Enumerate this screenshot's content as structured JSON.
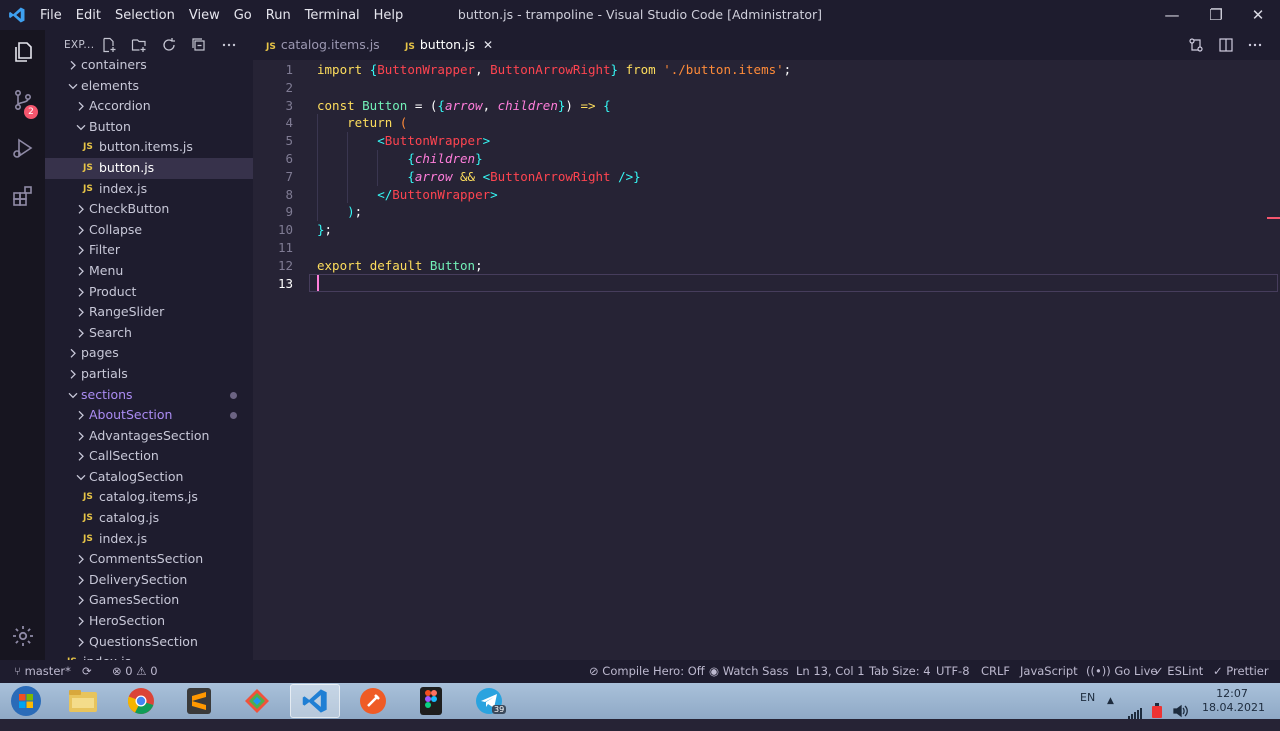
{
  "titlebar": {
    "menu": [
      "File",
      "Edit",
      "Selection",
      "View",
      "Go",
      "Run",
      "Terminal",
      "Help"
    ],
    "window_title": "button.js - trampoline - Visual Studio Code [Administrator]",
    "minimize": "—",
    "maximize": "❐",
    "close": "✕"
  },
  "activity": {
    "scm_badge": "2"
  },
  "sidebar": {
    "header": "EXP...",
    "tree": [
      {
        "label": "containers",
        "depth": 1,
        "chev": "right"
      },
      {
        "label": "elements",
        "depth": 1,
        "chev": "down"
      },
      {
        "label": "Accordion",
        "depth": 2,
        "chev": "right"
      },
      {
        "label": "Button",
        "depth": 2,
        "chev": "down"
      },
      {
        "label": "button.items.js",
        "depth": 3,
        "file": "JS"
      },
      {
        "label": "button.js",
        "depth": 3,
        "file": "JS",
        "selected": true
      },
      {
        "label": "index.js",
        "depth": 3,
        "file": "JS"
      },
      {
        "label": "CheckButton",
        "depth": 2,
        "chev": "right"
      },
      {
        "label": "Collapse",
        "depth": 2,
        "chev": "right"
      },
      {
        "label": "Filter",
        "depth": 2,
        "chev": "right"
      },
      {
        "label": "Menu",
        "depth": 2,
        "chev": "right"
      },
      {
        "label": "Product",
        "depth": 2,
        "chev": "right"
      },
      {
        "label": "RangeSlider",
        "depth": 2,
        "chev": "right"
      },
      {
        "label": "Search",
        "depth": 2,
        "chev": "right"
      },
      {
        "label": "pages",
        "depth": 1,
        "chev": "right"
      },
      {
        "label": "partials",
        "depth": 1,
        "chev": "right"
      },
      {
        "label": "sections",
        "depth": 1,
        "chev": "down",
        "modified": true
      },
      {
        "label": "AboutSection",
        "depth": 2,
        "chev": "right",
        "modified": true
      },
      {
        "label": "AdvantagesSection",
        "depth": 2,
        "chev": "right"
      },
      {
        "label": "CallSection",
        "depth": 2,
        "chev": "right"
      },
      {
        "label": "CatalogSection",
        "depth": 2,
        "chev": "down"
      },
      {
        "label": "catalog.items.js",
        "depth": 3,
        "file": "JS"
      },
      {
        "label": "catalog.js",
        "depth": 3,
        "file": "JS"
      },
      {
        "label": "index.js",
        "depth": 3,
        "file": "JS"
      },
      {
        "label": "CommentsSection",
        "depth": 2,
        "chev": "right"
      },
      {
        "label": "DeliverySection",
        "depth": 2,
        "chev": "right"
      },
      {
        "label": "GamesSection",
        "depth": 2,
        "chev": "right"
      },
      {
        "label": "HeroSection",
        "depth": 2,
        "chev": "right"
      },
      {
        "label": "QuestionsSection",
        "depth": 2,
        "chev": "right"
      },
      {
        "label": "index.js",
        "depth": 1,
        "file": "JS"
      }
    ]
  },
  "tabs": [
    {
      "label": "catalog.items.js",
      "icon": "JS",
      "active": false
    },
    {
      "label": "button.js",
      "icon": "JS",
      "active": true,
      "close": "✕"
    }
  ],
  "editor": {
    "lines": [
      [
        [
          "kw",
          "import "
        ],
        [
          "b",
          "{"
        ],
        [
          "t",
          "ButtonWrapper"
        ],
        [
          "o",
          ", "
        ],
        [
          "t",
          "ButtonArrowRight"
        ],
        [
          "b",
          "}"
        ],
        [
          "kw",
          " from "
        ],
        [
          "s",
          "'./button.items'"
        ],
        [
          "o",
          ";"
        ]
      ],
      [],
      [
        [
          "kw",
          "const "
        ],
        [
          "p",
          "Button"
        ],
        [
          "o",
          " = ("
        ],
        [
          "b",
          "{"
        ],
        [
          "pa",
          "arrow"
        ],
        [
          "o",
          ", "
        ],
        [
          "pa",
          "children"
        ],
        [
          "b",
          "}"
        ],
        [
          "o",
          ") "
        ],
        [
          "kw",
          "=>"
        ],
        [
          "o",
          " "
        ],
        [
          "b",
          "{"
        ]
      ],
      [
        [
          "o",
          "    "
        ],
        [
          "kw",
          "return"
        ],
        [
          "o",
          " "
        ],
        [
          "s",
          "("
        ]
      ],
      [
        [
          "o",
          "        "
        ],
        [
          "b",
          "<"
        ],
        [
          "t",
          "ButtonWrapper"
        ],
        [
          "b",
          ">"
        ]
      ],
      [
        [
          "o",
          "            "
        ],
        [
          "b",
          "{"
        ],
        [
          "pa",
          "children"
        ],
        [
          "b",
          "}"
        ]
      ],
      [
        [
          "o",
          "            "
        ],
        [
          "b",
          "{"
        ],
        [
          "pa",
          "arrow"
        ],
        [
          "o",
          " "
        ],
        [
          "kw",
          "&&"
        ],
        [
          "o",
          " "
        ],
        [
          "b",
          "<"
        ],
        [
          "t",
          "ButtonArrowRight"
        ],
        [
          "o",
          " "
        ],
        [
          "b",
          "/>"
        ],
        [
          "b",
          "}"
        ]
      ],
      [
        [
          "o",
          "        "
        ],
        [
          "b",
          "</"
        ],
        [
          "t",
          "ButtonWrapper"
        ],
        [
          "b",
          ">"
        ]
      ],
      [
        [
          "o",
          "    "
        ],
        [
          "b",
          ")"
        ],
        [
          "o",
          ";"
        ]
      ],
      [
        [
          "b",
          "}"
        ],
        [
          "o",
          ";"
        ]
      ],
      [],
      [
        [
          "kw",
          "export "
        ],
        [
          "kw",
          "default "
        ],
        [
          "p",
          "Button"
        ],
        [
          "o",
          ";"
        ]
      ],
      []
    ],
    "line_numbers": [
      "1",
      "2",
      "3",
      "4",
      "5",
      "6",
      "7",
      "8",
      "9",
      "10",
      "11",
      "12",
      "13"
    ],
    "current_line": 13
  },
  "statusbar": {
    "branch": "master*",
    "errors": "0",
    "warnings": "0",
    "compile_hero": "Compile Hero: Off",
    "watch_sass": "Watch Sass",
    "position": "Ln 13, Col 1",
    "tab_size": "Tab Size: 4",
    "encoding": "UTF-8",
    "eol": "CRLF",
    "language": "JavaScript",
    "go_live": "Go Live",
    "eslint": "ESLint",
    "prettier": "Prettier"
  },
  "taskbar": {
    "apps": [
      "start-orb",
      "file-explorer",
      "chrome",
      "sublime-text",
      "sourcetree",
      "vscode",
      "postman",
      "figma",
      "telegram"
    ],
    "telegram_badge": "39",
    "lang": "EN",
    "time": "12:07",
    "date": "18.04.2021"
  },
  "colors": {
    "keyword": "#fede5d",
    "brace": "#36f9f6",
    "string": "#ff8b39",
    "tag": "#fe4450",
    "param": "#ff7edb",
    "identifier": "#72f1b8"
  }
}
